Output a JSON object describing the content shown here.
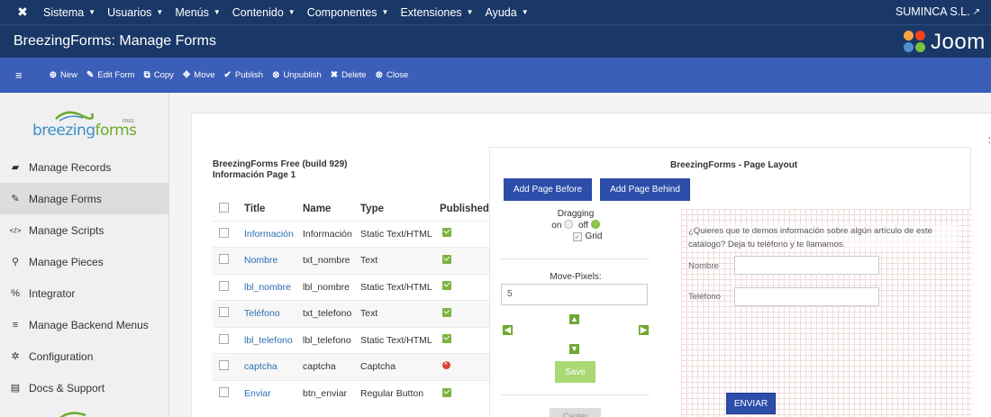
{
  "topbar": {
    "menu": [
      "Sistema",
      "Usuarios",
      "Menús",
      "Contenido",
      "Componentes",
      "Extensiones",
      "Ayuda"
    ],
    "site": "SUMINCA S.L."
  },
  "header": {
    "title": "BreezingForms: Manage Forms",
    "brand": "Joom"
  },
  "toolbar": {
    "buttons": [
      {
        "label": "New",
        "icon": "plus-circle-icon"
      },
      {
        "label": "Edit Form",
        "icon": "edit-icon"
      },
      {
        "label": "Copy",
        "icon": "copy-icon"
      },
      {
        "label": "Move",
        "icon": "move-icon"
      },
      {
        "label": "Publish",
        "icon": "check-icon"
      },
      {
        "label": "Unpublish",
        "icon": "unpublish-icon"
      },
      {
        "label": "Delete",
        "icon": "x-icon"
      },
      {
        "label": "Close",
        "icon": "close-circle-icon"
      }
    ]
  },
  "sidebar": {
    "logo": {
      "brand_a": "breezing",
      "brand_b": "forms",
      "badge": "FREE"
    },
    "items": [
      {
        "label": "Manage Records",
        "icon": "folder-open-icon"
      },
      {
        "label": "Manage Forms",
        "icon": "edit-icon"
      },
      {
        "label": "Manage Scripts",
        "icon": "code-icon"
      },
      {
        "label": "Manage Pieces",
        "icon": "sitemap-icon"
      },
      {
        "label": "Integrator",
        "icon": "percent-icon"
      },
      {
        "label": "Manage Backend Menus",
        "icon": "list-icon"
      },
      {
        "label": "Configuration",
        "icon": "gear-icon"
      },
      {
        "label": "Docs & Support",
        "icon": "document-icon"
      }
    ],
    "active_index": 1
  },
  "main": {
    "build_line1": "BreezingForms Free (build 929)",
    "build_line2": "Información Page 1",
    "columns": [
      "Title",
      "Name",
      "Type",
      "Published"
    ],
    "rows": [
      {
        "title": "Información",
        "name": "Información",
        "type": "Static Text/HTML",
        "published": true
      },
      {
        "title": "Nombre",
        "name": "txt_nombre",
        "type": "Text",
        "published": true
      },
      {
        "title": "lbl_nombre",
        "name": "lbl_nombre",
        "type": "Static Text/HTML",
        "published": true
      },
      {
        "title": "Teléfono",
        "name": "txt_telefono",
        "type": "Text",
        "published": true
      },
      {
        "title": "lbl_telefono",
        "name": "lbl_telefono",
        "type": "Static Text/HTML",
        "published": true
      },
      {
        "title": "captcha",
        "name": "captcha",
        "type": "Captcha",
        "published": false
      },
      {
        "title": "Enviar",
        "name": "btn_enviar",
        "type": "Regular Button",
        "published": true
      }
    ]
  },
  "layout": {
    "title": "BreezingForms - Page Layout",
    "add_before": "Add Page Before",
    "add_behind": "Add Page Behind",
    "dragging_label": "Dragging",
    "on_label": "on",
    "off_label": "off",
    "grid_label": "Grid",
    "move_pixels_label": "Move-Pixels:",
    "move_pixels_value": "5",
    "save_label": "Save",
    "bottom_button_label": "Center",
    "preview": {
      "question": "¿Quieres que te demos información sobre algún artículo de este catálogo? Deja tu teléfono y te llamamos.",
      "label_name": "Nombre",
      "label_phone": "Teléfono",
      "submit": "ENVIAR"
    }
  }
}
